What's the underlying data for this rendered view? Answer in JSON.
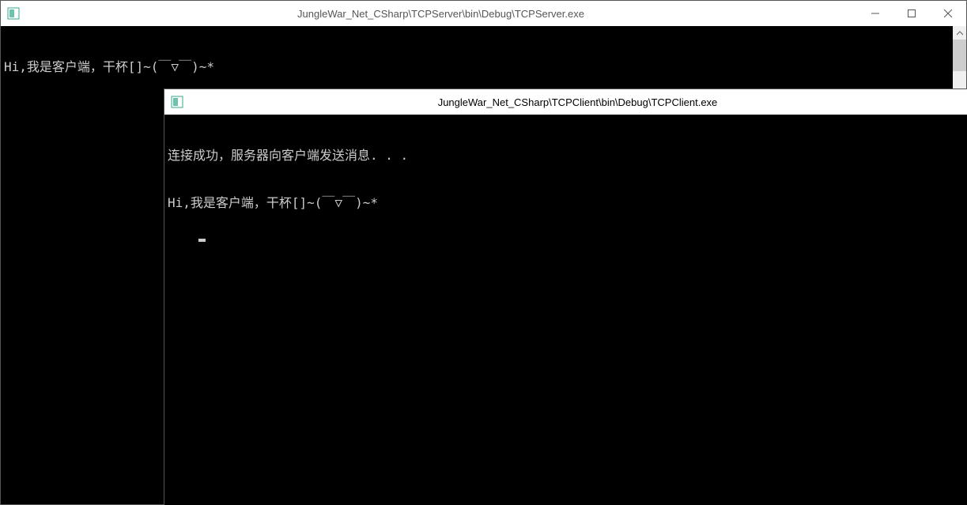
{
  "back_window": {
    "title": "JungleWar_Net_CSharp\\TCPServer\\bin\\Debug\\TCPServer.exe",
    "lines": [
      "Hi,我是客户端，干杯[]~(￣▽￣)~*"
    ]
  },
  "front_window": {
    "title": "JungleWar_Net_CSharp\\TCPClient\\bin\\Debug\\TCPClient.exe",
    "lines": [
      "连接成功，服务器向客户端发送消息. . .",
      "Hi,我是客户端，干杯[]~(￣▽￣)~*"
    ]
  }
}
